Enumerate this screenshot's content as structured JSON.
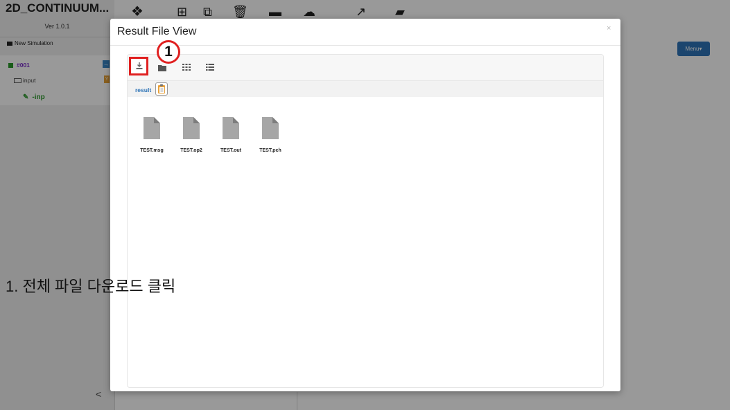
{
  "app": {
    "title": "2D_CONTINUUM...",
    "version": "Ver 1.0.1",
    "new_simulation": "New Simulation",
    "tree": {
      "sim_label": "#001",
      "input_label": "input",
      "inp_label": "-inp"
    },
    "menu_button": "Menu",
    "collapse_glyph": "<"
  },
  "modal": {
    "title": "Result File View",
    "close_glyph": "×",
    "path_label": "result",
    "toolbar_icons": [
      "download-all-icon",
      "folder-icon",
      "grid-view-icon",
      "list-view-icon"
    ],
    "files": [
      {
        "name": "TEST.msg"
      },
      {
        "name": "TEST.op2"
      },
      {
        "name": "TEST.out"
      },
      {
        "name": "TEST.pch"
      }
    ]
  },
  "annotation": {
    "step_number": "1",
    "caption": "1. 전체 파일 다운로드 클릭"
  },
  "colors": {
    "highlight_red": "#e02020",
    "link_blue": "#2e74b7",
    "menu_blue": "#2e74b7",
    "file_gray": "#a6a6a6"
  }
}
